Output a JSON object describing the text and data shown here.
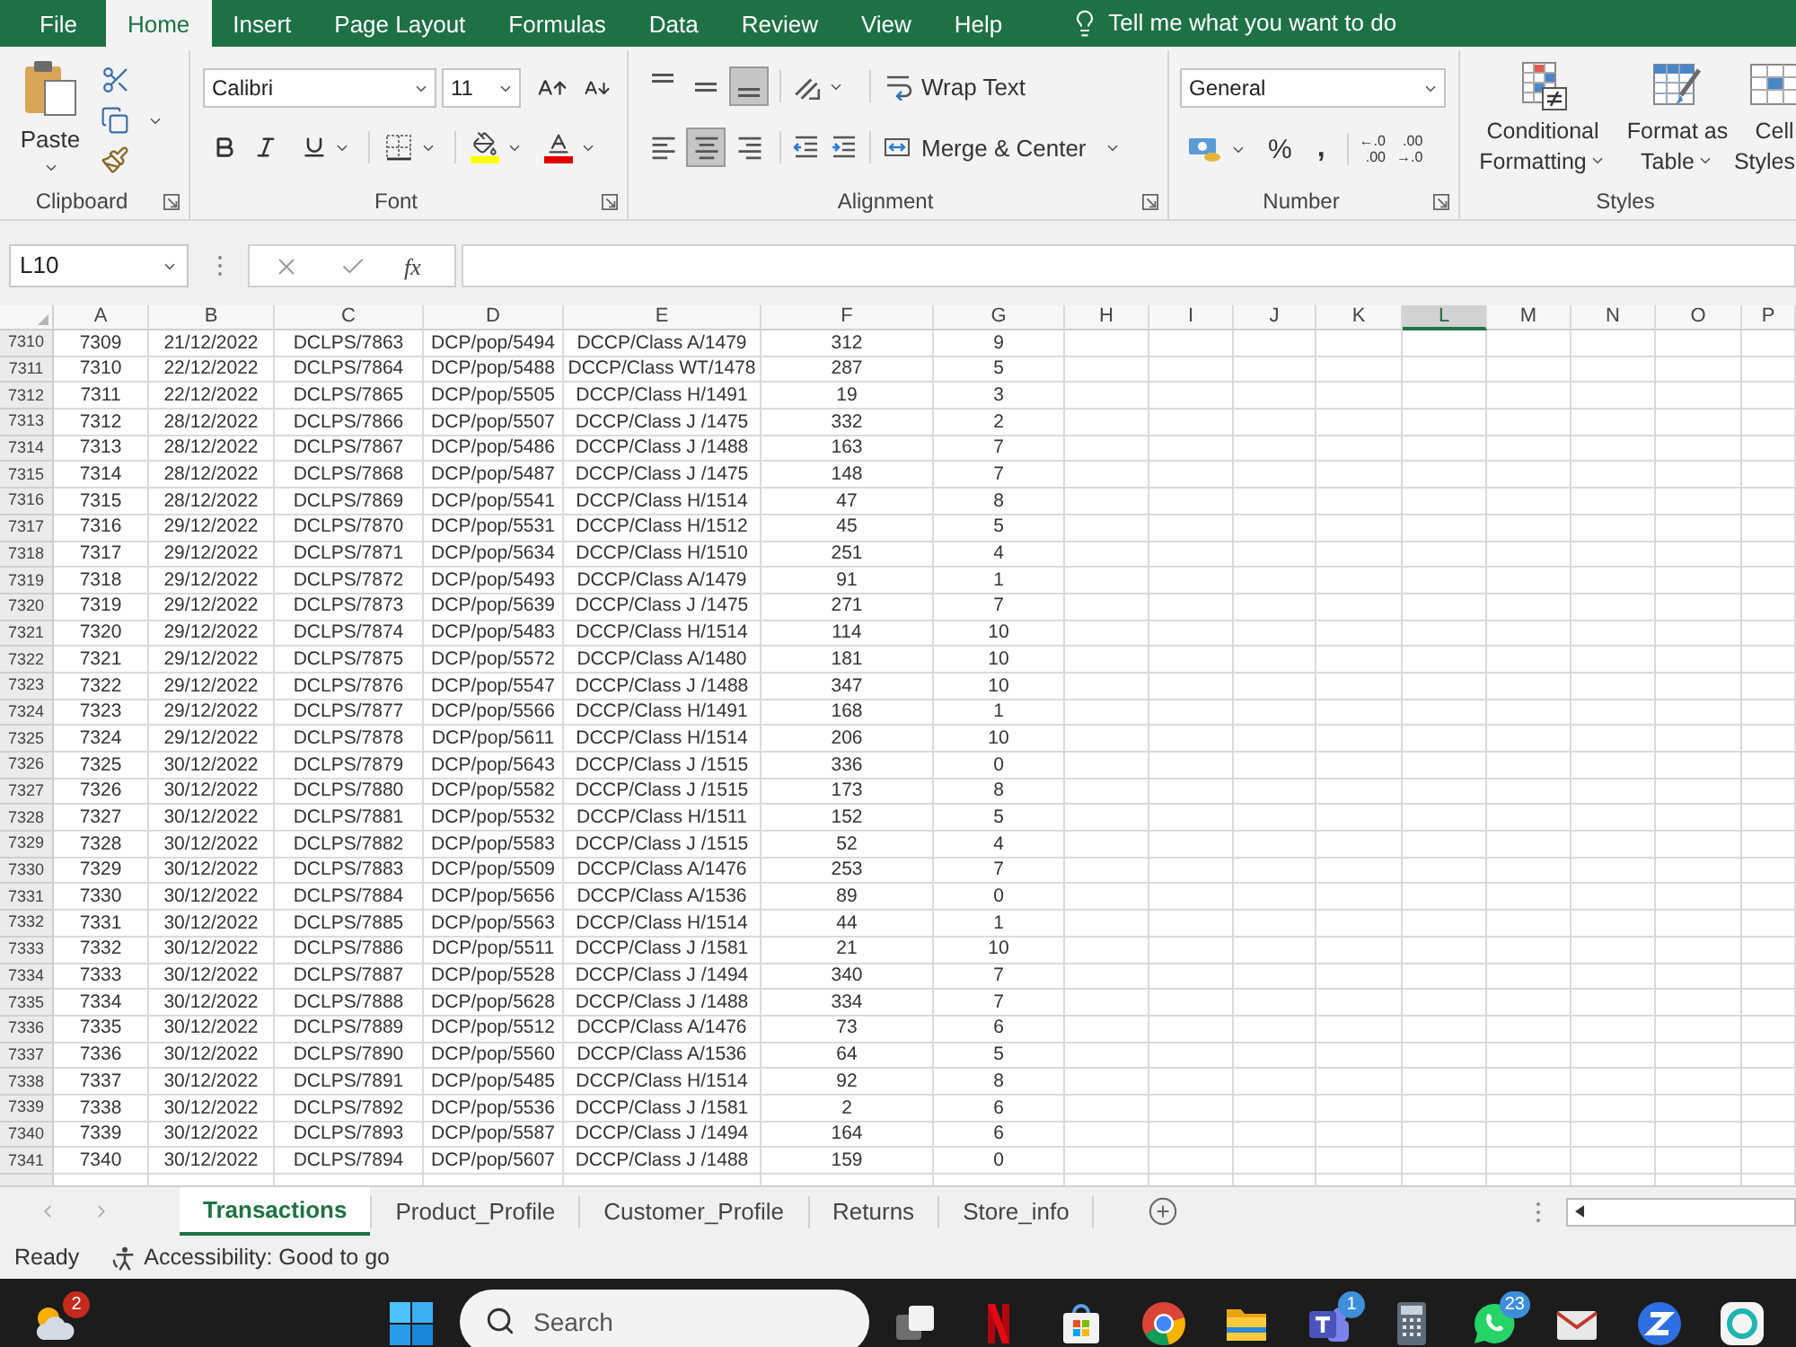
{
  "menu": {
    "tabs": [
      {
        "label": "File",
        "selected": false
      },
      {
        "label": "Home",
        "selected": true
      },
      {
        "label": "Insert",
        "selected": false
      },
      {
        "label": "Page Layout",
        "selected": false
      },
      {
        "label": "Formulas",
        "selected": false
      },
      {
        "label": "Data",
        "selected": false
      },
      {
        "label": "Review",
        "selected": false
      },
      {
        "label": "View",
        "selected": false
      },
      {
        "label": "Help",
        "selected": false
      }
    ],
    "tell_me": {
      "placeholder": "Tell me what you want to do"
    }
  },
  "ribbon": {
    "clipboard": {
      "paste": "Paste",
      "label": "Clipboard"
    },
    "font": {
      "font_name": "Calibri",
      "font_size": "11",
      "label": "Font"
    },
    "alignment": {
      "vertical_align": [
        {
          "kind": "top",
          "selected": false
        },
        {
          "kind": "middle",
          "selected": false
        },
        {
          "kind": "bottom",
          "selected": true
        }
      ],
      "horizontal_align": [
        {
          "kind": "left",
          "selected": false
        },
        {
          "kind": "center",
          "selected": true
        },
        {
          "kind": "right",
          "selected": false
        }
      ],
      "wrap_text": "Wrap Text",
      "merge_center": "Merge & Center",
      "label": "Alignment"
    },
    "number": {
      "format": "General",
      "percent": "%",
      "comma": ",",
      "decimals": [
        {
          "top": "←.0",
          "bottom": ".00"
        },
        {
          "top": ".00",
          "bottom": "→.0"
        }
      ],
      "label": "Number"
    },
    "styles": {
      "buttons": [
        {
          "kind": "conditional",
          "lines": [
            "Conditional",
            "Formatting"
          ]
        },
        {
          "kind": "table",
          "lines": [
            "Format as",
            "Table"
          ]
        },
        {
          "kind": "cell",
          "lines": [
            "Cell",
            "Styles"
          ]
        }
      ],
      "label": "Styles"
    }
  },
  "formula_bar": {
    "name_box": "L10",
    "function_label": "fx"
  },
  "sheet": {
    "columns": [
      {
        "label": "A",
        "selected": false
      },
      {
        "label": "B",
        "selected": false
      },
      {
        "label": "C",
        "selected": false
      },
      {
        "label": "D",
        "selected": false
      },
      {
        "label": "E",
        "selected": false
      },
      {
        "label": "F",
        "selected": false
      },
      {
        "label": "G",
        "selected": false
      },
      {
        "label": "H",
        "selected": false
      },
      {
        "label": "I",
        "selected": false
      },
      {
        "label": "J",
        "selected": false
      },
      {
        "label": "K",
        "selected": false
      },
      {
        "label": "L",
        "selected": true
      },
      {
        "label": "M",
        "selected": false
      },
      {
        "label": "N",
        "selected": false
      },
      {
        "label": "O",
        "selected": false
      },
      {
        "label": "P",
        "selected": false
      }
    ],
    "rows": [
      {
        "header": "7310",
        "cells": [
          "7309",
          "21/12/2022",
          "DCLPS/7863",
          "DCP/pop/5494",
          "DCCP/Class A/1479",
          "312",
          "9"
        ]
      },
      {
        "header": "7311",
        "cells": [
          "7310",
          "22/12/2022",
          "DCLPS/7864",
          "DCP/pop/5488",
          "DCCP/Class WT/1478",
          "287",
          "5"
        ]
      },
      {
        "header": "7312",
        "cells": [
          "7311",
          "22/12/2022",
          "DCLPS/7865",
          "DCP/pop/5505",
          "DCCP/Class H/1491",
          "19",
          "3"
        ]
      },
      {
        "header": "7313",
        "cells": [
          "7312",
          "28/12/2022",
          "DCLPS/7866",
          "DCP/pop/5507",
          "DCCP/Class J /1475",
          "332",
          "2"
        ]
      },
      {
        "header": "7314",
        "cells": [
          "7313",
          "28/12/2022",
          "DCLPS/7867",
          "DCP/pop/5486",
          "DCCP/Class J /1488",
          "163",
          "7"
        ]
      },
      {
        "header": "7315",
        "cells": [
          "7314",
          "28/12/2022",
          "DCLPS/7868",
          "DCP/pop/5487",
          "DCCP/Class J /1475",
          "148",
          "7"
        ]
      },
      {
        "header": "7316",
        "cells": [
          "7315",
          "28/12/2022",
          "DCLPS/7869",
          "DCP/pop/5541",
          "DCCP/Class H/1514",
          "47",
          "8"
        ]
      },
      {
        "header": "7317",
        "cells": [
          "7316",
          "29/12/2022",
          "DCLPS/7870",
          "DCP/pop/5531",
          "DCCP/Class H/1512",
          "45",
          "5"
        ]
      },
      {
        "header": "7318",
        "cells": [
          "7317",
          "29/12/2022",
          "DCLPS/7871",
          "DCP/pop/5634",
          "DCCP/Class H/1510",
          "251",
          "4"
        ]
      },
      {
        "header": "7319",
        "cells": [
          "7318",
          "29/12/2022",
          "DCLPS/7872",
          "DCP/pop/5493",
          "DCCP/Class A/1479",
          "91",
          "1"
        ]
      },
      {
        "header": "7320",
        "cells": [
          "7319",
          "29/12/2022",
          "DCLPS/7873",
          "DCP/pop/5639",
          "DCCP/Class J /1475",
          "271",
          "7"
        ]
      },
      {
        "header": "7321",
        "cells": [
          "7320",
          "29/12/2022",
          "DCLPS/7874",
          "DCP/pop/5483",
          "DCCP/Class H/1514",
          "114",
          "10"
        ]
      },
      {
        "header": "7322",
        "cells": [
          "7321",
          "29/12/2022",
          "DCLPS/7875",
          "DCP/pop/5572",
          "DCCP/Class A/1480",
          "181",
          "10"
        ]
      },
      {
        "header": "7323",
        "cells": [
          "7322",
          "29/12/2022",
          "DCLPS/7876",
          "DCP/pop/5547",
          "DCCP/Class J /1488",
          "347",
          "10"
        ]
      },
      {
        "header": "7324",
        "cells": [
          "7323",
          "29/12/2022",
          "DCLPS/7877",
          "DCP/pop/5566",
          "DCCP/Class H/1491",
          "168",
          "1"
        ]
      },
      {
        "header": "7325",
        "cells": [
          "7324",
          "29/12/2022",
          "DCLPS/7878",
          "DCP/pop/5611",
          "DCCP/Class H/1514",
          "206",
          "10"
        ]
      },
      {
        "header": "7326",
        "cells": [
          "7325",
          "30/12/2022",
          "DCLPS/7879",
          "DCP/pop/5643",
          "DCCP/Class J /1515",
          "336",
          "0"
        ]
      },
      {
        "header": "7327",
        "cells": [
          "7326",
          "30/12/2022",
          "DCLPS/7880",
          "DCP/pop/5582",
          "DCCP/Class J /1515",
          "173",
          "8"
        ]
      },
      {
        "header": "7328",
        "cells": [
          "7327",
          "30/12/2022",
          "DCLPS/7881",
          "DCP/pop/5532",
          "DCCP/Class H/1511",
          "152",
          "5"
        ]
      },
      {
        "header": "7329",
        "cells": [
          "7328",
          "30/12/2022",
          "DCLPS/7882",
          "DCP/pop/5583",
          "DCCP/Class J /1515",
          "52",
          "4"
        ]
      },
      {
        "header": "7330",
        "cells": [
          "7329",
          "30/12/2022",
          "DCLPS/7883",
          "DCP/pop/5509",
          "DCCP/Class A/1476",
          "253",
          "7"
        ]
      },
      {
        "header": "7331",
        "cells": [
          "7330",
          "30/12/2022",
          "DCLPS/7884",
          "DCP/pop/5656",
          "DCCP/Class A/1536",
          "89",
          "0"
        ]
      },
      {
        "header": "7332",
        "cells": [
          "7331",
          "30/12/2022",
          "DCLPS/7885",
          "DCP/pop/5563",
          "DCCP/Class H/1514",
          "44",
          "1"
        ]
      },
      {
        "header": "7333",
        "cells": [
          "7332",
          "30/12/2022",
          "DCLPS/7886",
          "DCP/pop/5511",
          "DCCP/Class J /1581",
          "21",
          "10"
        ]
      },
      {
        "header": "7334",
        "cells": [
          "7333",
          "30/12/2022",
          "DCLPS/7887",
          "DCP/pop/5528",
          "DCCP/Class J /1494",
          "340",
          "7"
        ]
      },
      {
        "header": "7335",
        "cells": [
          "7334",
          "30/12/2022",
          "DCLPS/7888",
          "DCP/pop/5628",
          "DCCP/Class J /1488",
          "334",
          "7"
        ]
      },
      {
        "header": "7336",
        "cells": [
          "7335",
          "30/12/2022",
          "DCLPS/7889",
          "DCP/pop/5512",
          "DCCP/Class A/1476",
          "73",
          "6"
        ]
      },
      {
        "header": "7337",
        "cells": [
          "7336",
          "30/12/2022",
          "DCLPS/7890",
          "DCP/pop/5560",
          "DCCP/Class A/1536",
          "64",
          "5"
        ]
      },
      {
        "header": "7338",
        "cells": [
          "7337",
          "30/12/2022",
          "DCLPS/7891",
          "DCP/pop/5485",
          "DCCP/Class H/1514",
          "92",
          "8"
        ]
      },
      {
        "header": "7339",
        "cells": [
          "7338",
          "30/12/2022",
          "DCLPS/7892",
          "DCP/pop/5536",
          "DCCP/Class J /1581",
          "2",
          "6"
        ]
      },
      {
        "header": "7340",
        "cells": [
          "7339",
          "30/12/2022",
          "DCLPS/7893",
          "DCP/pop/5587",
          "DCCP/Class J /1494",
          "164",
          "6"
        ]
      },
      {
        "header": "7341",
        "cells": [
          "7340",
          "30/12/2022",
          "DCLPS/7894",
          "DCP/pop/5607",
          "DCCP/Class J /1488",
          "159",
          "0"
        ]
      }
    ]
  },
  "sheet_tabs": [
    {
      "label": "Transactions",
      "selected": true
    },
    {
      "label": "Product_Profile",
      "selected": false
    },
    {
      "label": "Customer_Profile",
      "selected": false
    },
    {
      "label": "Returns",
      "selected": false
    },
    {
      "label": "Store_info",
      "selected": false
    }
  ],
  "status_bar": {
    "status": "Ready",
    "accessibility": "Accessibility: Good to go"
  },
  "taskbar": {
    "search": {
      "placeholder": "Search"
    },
    "apps": [
      {
        "kind": "weather",
        "badge": "2"
      },
      {
        "kind": "start"
      },
      {
        "kind": "task_view"
      },
      {
        "kind": "n_logo"
      },
      {
        "kind": "store"
      },
      {
        "kind": "browser"
      },
      {
        "kind": "folder"
      },
      {
        "kind": "t_tile",
        "badge": "1"
      },
      {
        "kind": "calculator"
      },
      {
        "kind": "chat",
        "badge": "23"
      },
      {
        "kind": "mail"
      },
      {
        "kind": "z_circle"
      },
      {
        "kind": "teal_app"
      }
    ]
  }
}
